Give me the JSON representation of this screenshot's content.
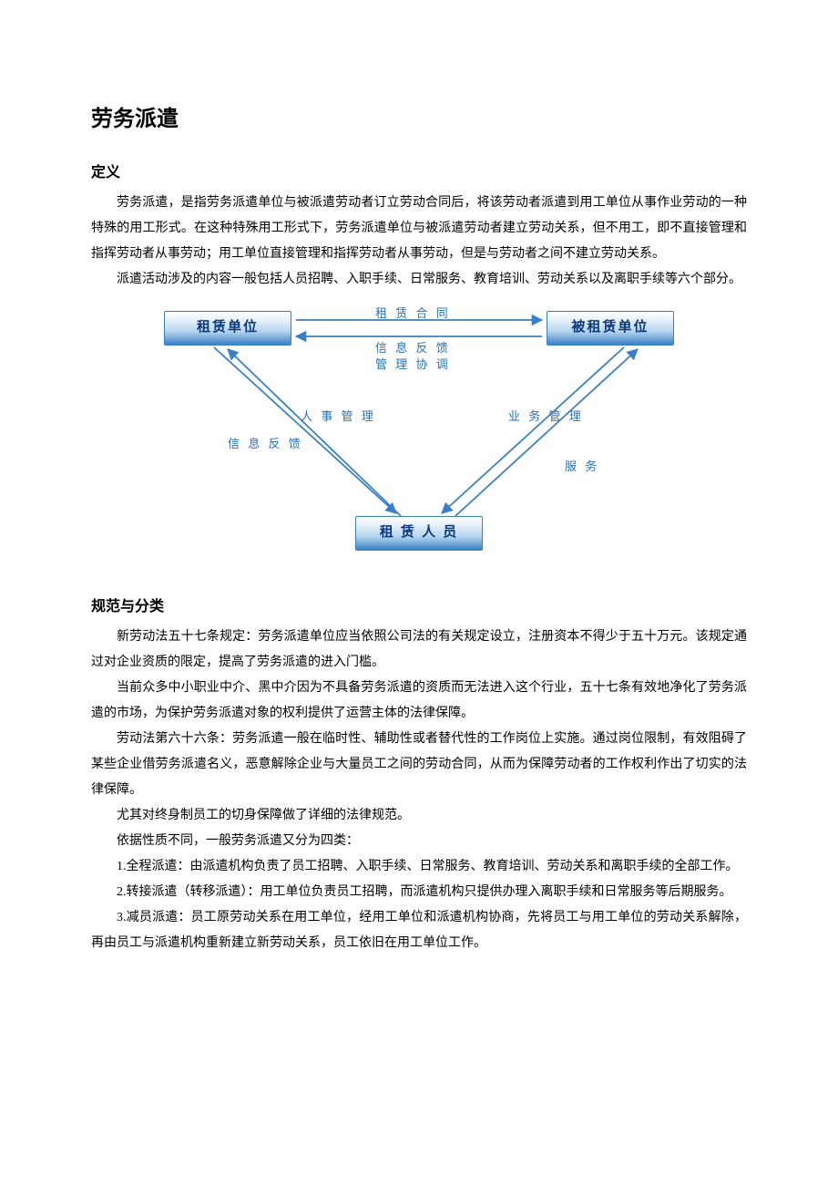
{
  "title": "劳务派遣",
  "section1": {
    "heading": "定义",
    "p1": "劳务派遣，是指劳务派遣单位与被派遣劳动者订立劳动合同后，将该劳动者派遣到用工单位从事作业劳动的一种特殊的用工形式。在这种特殊用工形式下，劳务派遣单位与被派遣劳动者建立劳动关系，但不用工，即不直接管理和指挥劳动者从事劳动；用工单位直接管理和指挥劳动者从事劳动，但是与劳动者之间不建立劳动关系。",
    "p2": "派遣活动涉及的内容一般包括人员招聘、入职手续、日常服务、教育培训、劳动关系以及离职手续等六个部分。"
  },
  "diagram": {
    "node_left": "租赁单位",
    "node_right": "被租赁单位",
    "node_bottom": "租 赁 人 员",
    "label_top1": "租 赁 合 同",
    "label_top2": "信 息 反 馈",
    "label_top3": "管 理 协 调",
    "label_left1": "人 事 管 理",
    "label_left2": "信 息 反 馈",
    "label_right1": "业 务 管 理",
    "label_right2": "服  务"
  },
  "section2": {
    "heading": "规范与分类",
    "p1": "新劳动法五十七条规定：劳务派遣单位应当依照公司法的有关规定设立，注册资本不得少于五十万元。该规定通过对企业资质的限定，提高了劳务派遣的进入门槛。",
    "p2": "当前众多中小职业中介、黑中介因为不具备劳务派遣的资质而无法进入这个行业，五十七条有效地净化了劳务派遣的市场，为保护劳务派遣对象的权利提供了运营主体的法律保障。",
    "p3": "劳动法第六十六条：劳务派遣一般在临时性、辅助性或者替代性的工作岗位上实施。通过岗位限制，有效阻碍了某些企业借劳务派遣名义，恶意解除企业与大量员工之间的劳动合同，从而为保障劳动者的工作权利作出了切实的法律保障。",
    "p4": "尤其对终身制员工的切身保障做了详细的法律规范。",
    "p5": "依据性质不同，一般劳务派遣又分为四类：",
    "p6": "1.全程派遣：由派遣机构负责了员工招聘、入职手续、日常服务、教育培训、劳动关系和离职手续的全部工作。",
    "p7": "2.转接派遣（转移派遣）：用工单位负责员工招聘，而派遣机构只提供办理入离职手续和日常服务等后期服务。",
    "p8": "3.减员派遣：员工原劳动关系在用工单位，经用工单位和派遣机构协商，先将员工与用工单位的劳动关系解除，再由员工与派遣机构重新建立新劳动关系，员工依旧在用工单位工作。"
  }
}
